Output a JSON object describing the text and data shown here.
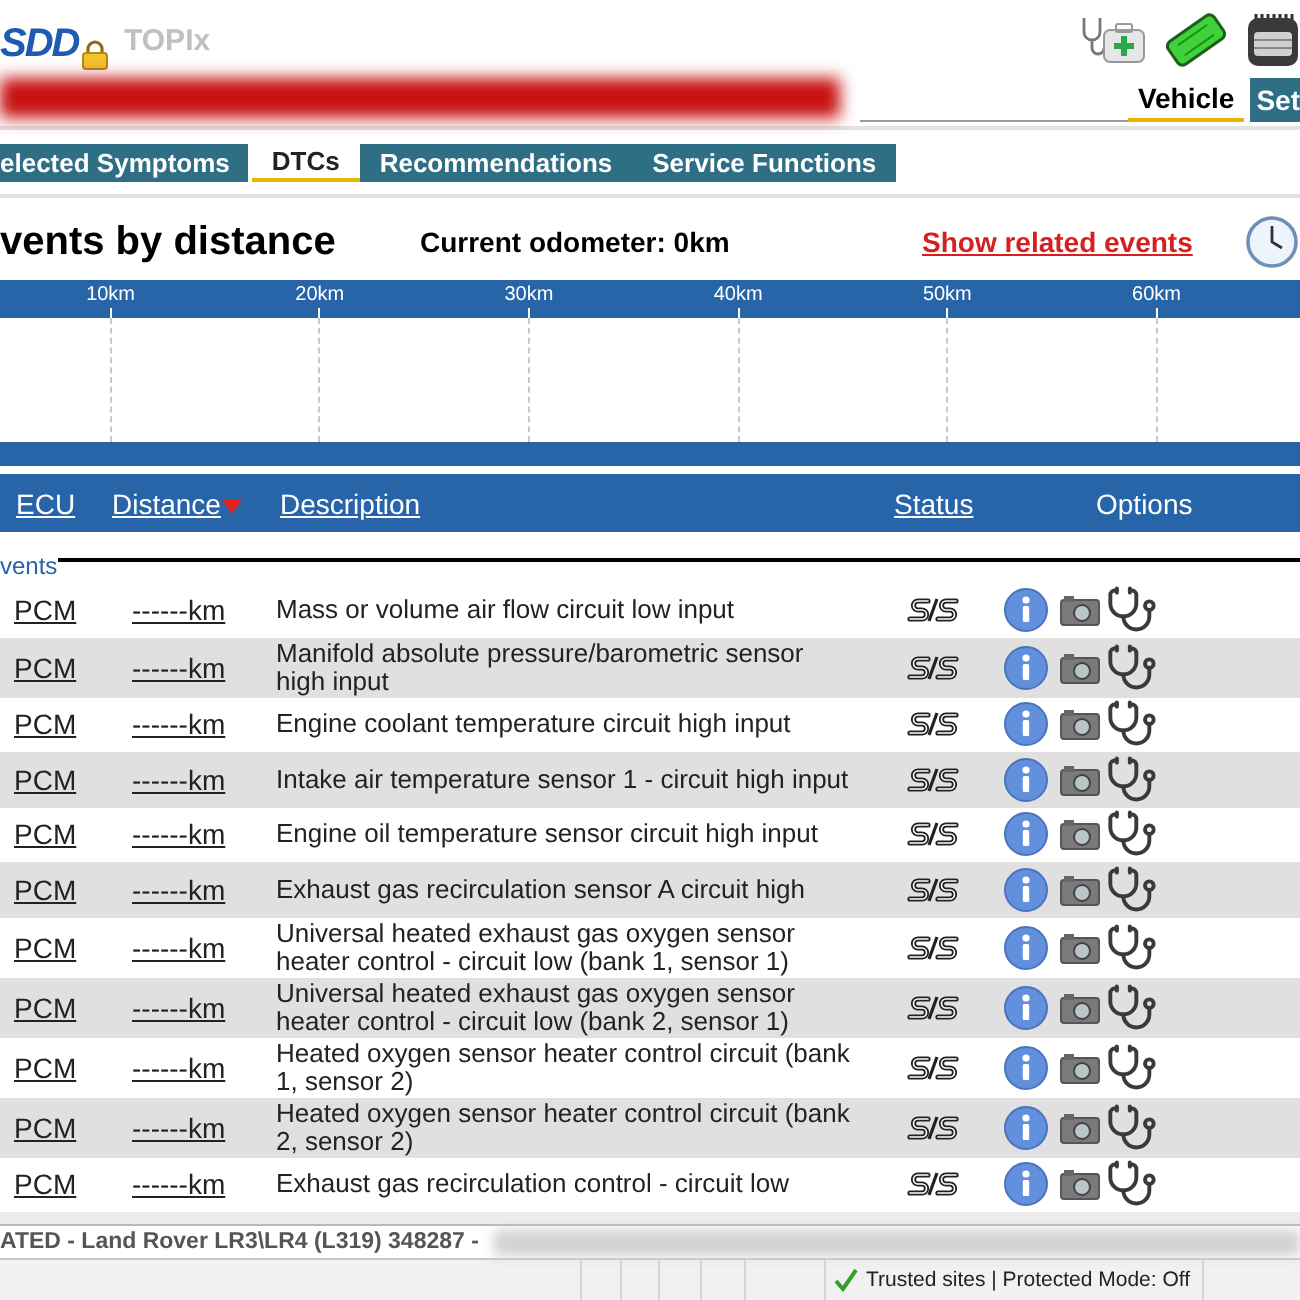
{
  "header": {
    "logo": "SDD",
    "app_name": "TOPIx"
  },
  "vehicle_tabs": [
    {
      "label": "Vehicle",
      "selected": true
    },
    {
      "label": "Set",
      "selected": false
    }
  ],
  "nav_tabs": [
    {
      "label": "elected Symptoms",
      "selected": false
    },
    {
      "label": "DTCs",
      "selected": true
    },
    {
      "label": "Recommendations",
      "selected": false
    },
    {
      "label": "Service Functions",
      "selected": false
    }
  ],
  "events": {
    "title": "vents by distance",
    "odometer": "Current odometer: 0km",
    "related_link": "Show related events",
    "scale_ticks": [
      "10km",
      "20km",
      "30km",
      "40km",
      "50km",
      "60km"
    ]
  },
  "table": {
    "columns": [
      {
        "label": "ECU",
        "sortable": true,
        "sorted": false
      },
      {
        "label": "Distance",
        "sortable": true,
        "sorted": true
      },
      {
        "label": "Description",
        "sortable": true,
        "sorted": false
      },
      {
        "label": "Status",
        "sortable": true,
        "sorted": false
      },
      {
        "label": "Options",
        "sortable": false,
        "sorted": false
      }
    ],
    "group": "vents",
    "rows": [
      {
        "ecu": "PCM",
        "distance": "------km",
        "description": "Mass or volume air flow circuit low input"
      },
      {
        "ecu": "PCM",
        "distance": "------km",
        "description": "Manifold absolute pressure/barometric sensor high input"
      },
      {
        "ecu": "PCM",
        "distance": "------km",
        "description": "Engine coolant temperature circuit high input"
      },
      {
        "ecu": "PCM",
        "distance": "------km",
        "description": "Intake air temperature sensor 1 - circuit high input"
      },
      {
        "ecu": "PCM",
        "distance": "------km",
        "description": "Engine oil temperature sensor circuit high input"
      },
      {
        "ecu": "PCM",
        "distance": "------km",
        "description": "Exhaust gas recirculation sensor A circuit high"
      },
      {
        "ecu": "PCM",
        "distance": "------km",
        "description": "Universal heated exhaust gas oxygen sensor heater control - circuit low (bank 1, sensor 1)"
      },
      {
        "ecu": "PCM",
        "distance": "------km",
        "description": "Universal heated exhaust gas oxygen sensor heater control - circuit low (bank 2, sensor 1)"
      },
      {
        "ecu": "PCM",
        "distance": "------km",
        "description": "Heated oxygen sensor heater control circuit (bank 1, sensor 2)"
      },
      {
        "ecu": "PCM",
        "distance": "------km",
        "description": "Heated oxygen sensor heater control circuit (bank 2, sensor 2)"
      },
      {
        "ecu": "PCM",
        "distance": "------km",
        "description": "Exhaust gas recirculation control - circuit low"
      }
    ]
  },
  "status_bar": {
    "text": "ATED - Land Rover LR3\\LR4 (L319) 348287 -"
  },
  "browser_status": {
    "text": "Trusted sites | Protected Mode: Off"
  }
}
